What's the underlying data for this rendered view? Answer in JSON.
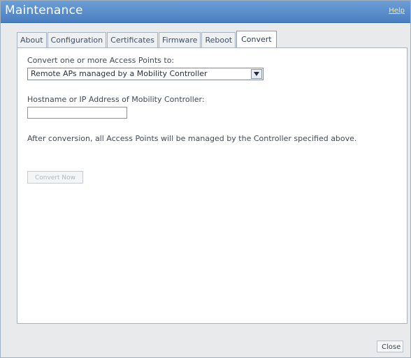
{
  "window": {
    "title": "Maintenance",
    "help_label": "Help"
  },
  "tabs": [
    {
      "label": "About",
      "active": false
    },
    {
      "label": "Configuration",
      "active": false
    },
    {
      "label": "Certificates",
      "active": false
    },
    {
      "label": "Firmware",
      "active": false
    },
    {
      "label": "Reboot",
      "active": false
    },
    {
      "label": "Convert",
      "active": true
    }
  ],
  "convert": {
    "convert_label": "Convert one or more Access Points to:",
    "selected_option": "Remote APs managed by a Mobility Controller",
    "hostname_label": "Hostname or IP Address of Mobility Controller:",
    "hostname_value": "",
    "info_text": "After conversion, all Access Points will be managed by the Controller specified above.",
    "convert_button_label": "Convert Now"
  },
  "footer": {
    "close_label": "Close"
  },
  "colors": {
    "titlebar": "#5a8fcd",
    "title_text": "#ffffff",
    "help_link": "#f6e7a8",
    "panel_bg": "#ffffff",
    "window_bg": "#e9eaec"
  },
  "icons": {
    "dropdown": "chevron-down-icon"
  }
}
